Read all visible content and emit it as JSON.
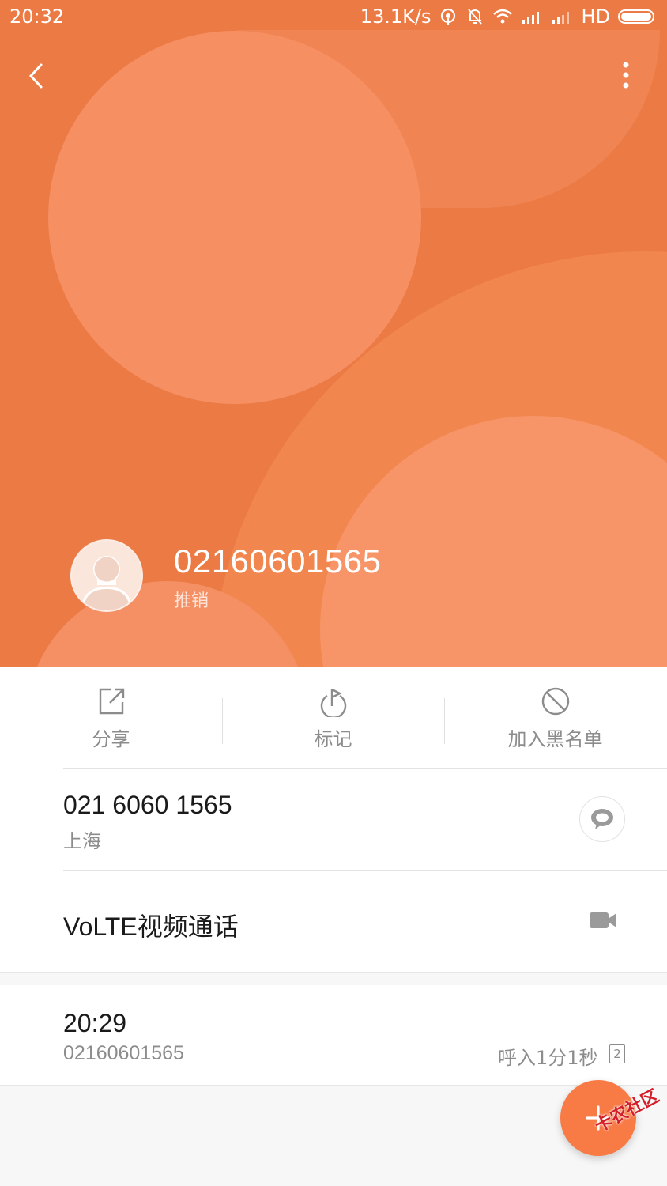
{
  "status_bar": {
    "time": "20:32",
    "speed": "13.1K/s",
    "network": "HD"
  },
  "header": {
    "number": "02160601565",
    "tag": "推销",
    "back_icon": "back-chevron-icon",
    "more_icon": "more-vertical-icon"
  },
  "actions": [
    {
      "label": "分享",
      "icon": "share-icon"
    },
    {
      "label": "标记",
      "icon": "flag-icon"
    },
    {
      "label": "加入黑名单",
      "icon": "block-icon"
    }
  ],
  "phone": {
    "number": "021 6060 1565",
    "location": "上海"
  },
  "video_call": {
    "label": "VoLTE视频通话"
  },
  "call_log": {
    "time": "20:29",
    "number": "02160601565",
    "detail": "呼入1分1秒",
    "sim": "2"
  },
  "watermark": "卡农社区",
  "colors": {
    "header_bg": "#eb7a45",
    "fab": "#f87a45"
  }
}
